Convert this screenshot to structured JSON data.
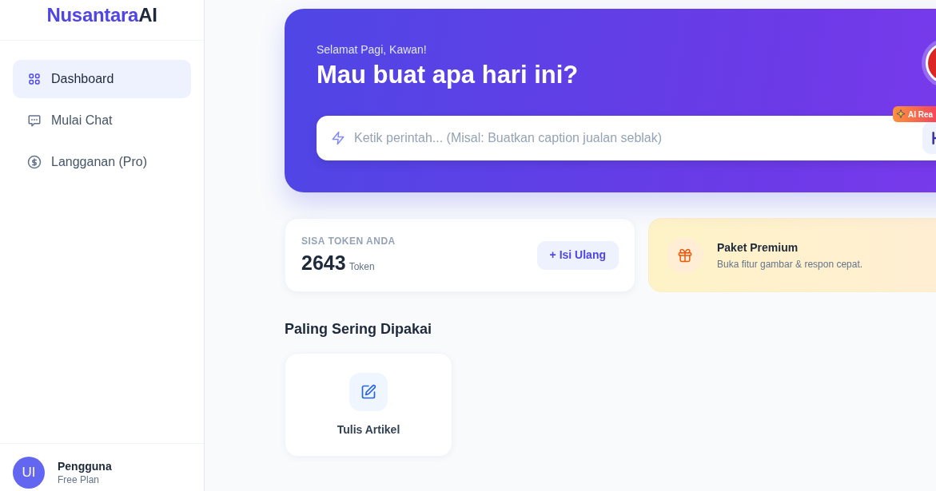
{
  "sidebar": {
    "logo": {
      "primary": "Nusantara",
      "accent": "AI"
    },
    "items": [
      {
        "label": "Dashboard",
        "selected": true
      },
      {
        "label": "Mulai Chat",
        "selected": false
      },
      {
        "label": "Langganan (Pro)",
        "selected": false
      }
    ],
    "user": {
      "initials": "UI",
      "name": "Pengguna",
      "plan": "Free Plan"
    }
  },
  "hero": {
    "greeting": "Selamat Pagi, Kawan!",
    "title": "Mau buat apa hari ini?",
    "prompt": {
      "placeholder": "Ketik perintah... (Misal: Buatkan caption jualan seblak)"
    },
    "badge": "AI Rea"
  },
  "token_card": {
    "label": "SISA TOKEN ANDA",
    "value": "2643",
    "unit": "Token",
    "button": "+ Isi Ulang"
  },
  "promo_card": {
    "title": "Paket Premium",
    "subtitle": "Buka fitur gambar & respon cepat."
  },
  "most_used": {
    "title": "Paling Sering Dipakai",
    "items": [
      {
        "label": "Tulis Artikel"
      }
    ]
  }
}
